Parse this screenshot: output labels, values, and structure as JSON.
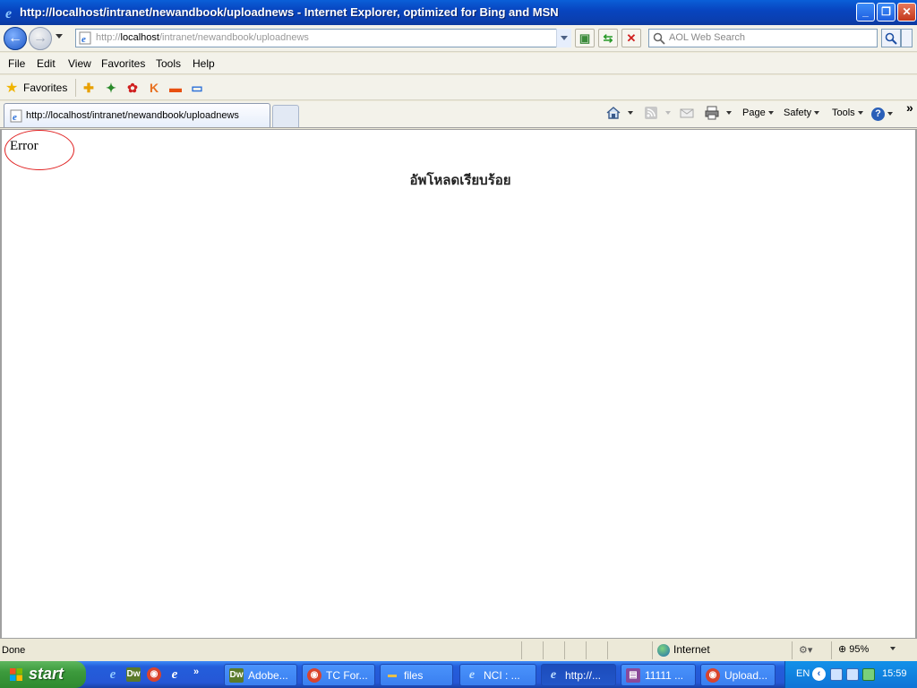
{
  "window": {
    "title": "http://localhost/intranet/newandbook/uploadnews - Internet Explorer, optimized for Bing and MSN",
    "minimize": "_",
    "maximize": "❐",
    "close": "✕"
  },
  "address": {
    "url_prefix": "http://",
    "url_host": "localhost",
    "url_path": "/intranet/newandbook/uploadnews",
    "search_placeholder": "AOL Web Search"
  },
  "menu": [
    "File",
    "Edit",
    "View",
    "Favorites",
    "Tools",
    "Help"
  ],
  "favorites_bar": {
    "label": "Favorites"
  },
  "tabs": [
    {
      "label": "http://localhost/intranet/newandbook/uploadnews"
    }
  ],
  "command_bar": {
    "page": "Page",
    "safety": "Safety",
    "tools": "Tools",
    "chevron": "»"
  },
  "content": {
    "error": "Error",
    "message": "อัพโหลดเรียบร้อย"
  },
  "status": {
    "text": "Done",
    "zone": "Internet",
    "zoom": "95%"
  },
  "taskbar": {
    "start": "start",
    "buttons": [
      {
        "label": "Adobe...",
        "icon": "dreamweaver-icon",
        "icon_text": "Dw",
        "icon_color": "#5a7a2a"
      },
      {
        "label": "TC For...",
        "icon": "chrome-icon",
        "icon_text": "◉",
        "icon_color": "#d9442d"
      },
      {
        "label": "files",
        "icon": "folder-icon",
        "icon_text": "▬",
        "icon_color": "#e8c04a"
      },
      {
        "label": "NCI : ...",
        "icon": "ie-icon",
        "icon_text": "e",
        "icon_color": "#2a6fd8"
      },
      {
        "label": "http://...",
        "icon": "ie-icon",
        "icon_text": "e",
        "icon_color": "#2a6fd8",
        "active": true
      },
      {
        "label": "11111 ...",
        "icon": "winrar-icon",
        "icon_text": "▤",
        "icon_color": "#8a4a9a"
      },
      {
        "label": "Upload...",
        "icon": "chrome-icon",
        "icon_text": "◉",
        "icon_color": "#d9442d"
      }
    ],
    "language": "EN",
    "clock": "15:59"
  }
}
